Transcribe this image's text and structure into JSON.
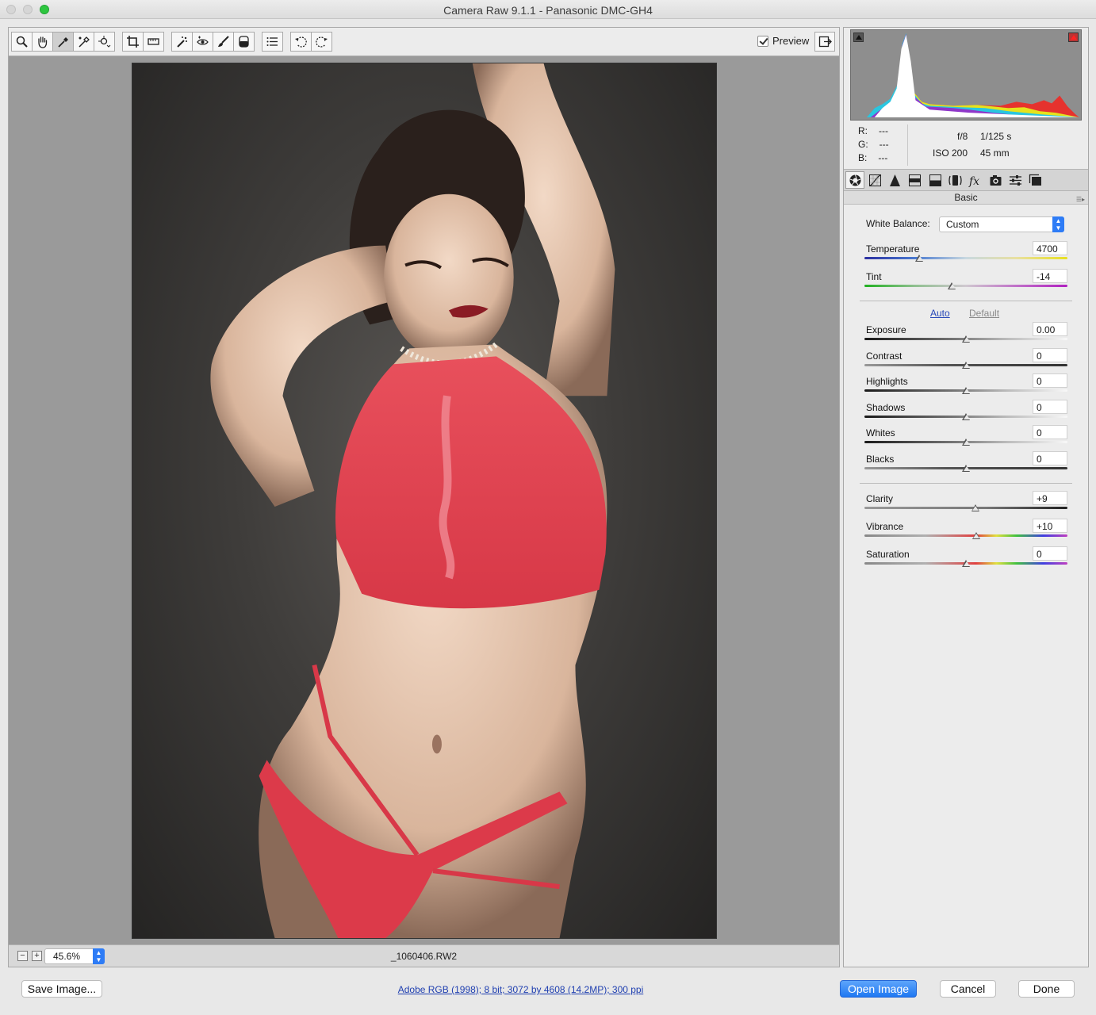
{
  "window": {
    "title": "Camera Raw 9.1.1  -  Panasonic DMC-GH4"
  },
  "toolbar": {
    "tools": [
      "zoom-tool",
      "hand-tool",
      "white-balance-tool",
      "color-sampler-tool",
      "targeted-adjustment-tool",
      "crop-tool",
      "straighten-tool",
      "spot-removal-tool",
      "red-eye-tool",
      "adjustment-brush",
      "graduated-filter",
      "radial-filter",
      "preferences",
      "rotate-left",
      "rotate-right"
    ],
    "active_tool": "white-balance-tool",
    "preview_label": "Preview",
    "preview_checked": true
  },
  "statusbar": {
    "zoom": "45.6%",
    "filename": "_1060406.RW2"
  },
  "histogram": {
    "rgb": {
      "r_label": "R:",
      "r": "---",
      "g_label": "G:",
      "g": "---",
      "b_label": "B:",
      "b": "---"
    },
    "exif": {
      "aperture": "f/8",
      "shutter": "1/125 s",
      "iso": "ISO 200",
      "focal": "45 mm"
    }
  },
  "panel": {
    "tabs": [
      "basic",
      "tone-curve",
      "detail",
      "hsl",
      "split-toning",
      "lens-corrections",
      "effects",
      "camera-calibration",
      "presets",
      "snapshots"
    ],
    "title": "Basic",
    "white_balance": {
      "label": "White Balance:",
      "value": "Custom"
    },
    "temperature": {
      "label": "Temperature",
      "value": "4700",
      "level": 0.27
    },
    "tint": {
      "label": "Tint",
      "value": "-14",
      "level": 0.43
    },
    "auto_label": "Auto",
    "default_label": "Default",
    "tone": [
      {
        "key": "exposure",
        "label": "Exposure",
        "value": "0.00",
        "level": 0.5
      },
      {
        "key": "contrast",
        "label": "Contrast",
        "value": "0",
        "level": 0.5
      },
      {
        "key": "highlights",
        "label": "Highlights",
        "value": "0",
        "level": 0.5
      },
      {
        "key": "shadows",
        "label": "Shadows",
        "value": "0",
        "level": 0.5
      },
      {
        "key": "whites",
        "label": "Whites",
        "value": "0",
        "level": 0.5
      },
      {
        "key": "blacks",
        "label": "Blacks",
        "value": "0",
        "level": 0.5
      }
    ],
    "presence": [
      {
        "key": "clarity",
        "label": "Clarity",
        "value": "+9",
        "level": 0.545
      },
      {
        "key": "vibrance",
        "label": "Vibrance",
        "value": "+10",
        "level": 0.55
      },
      {
        "key": "saturation",
        "label": "Saturation",
        "value": "0",
        "level": 0.5
      }
    ]
  },
  "footer": {
    "save_label": "Save Image...",
    "info_link": "Adobe RGB (1998); 8 bit; 3072 by 4608 (14.2MP); 300 ppi",
    "open_label": "Open Image",
    "cancel_label": "Cancel",
    "done_label": "Done"
  },
  "colors": {
    "accent": "#1f78f2",
    "link": "#1f3fb0"
  }
}
